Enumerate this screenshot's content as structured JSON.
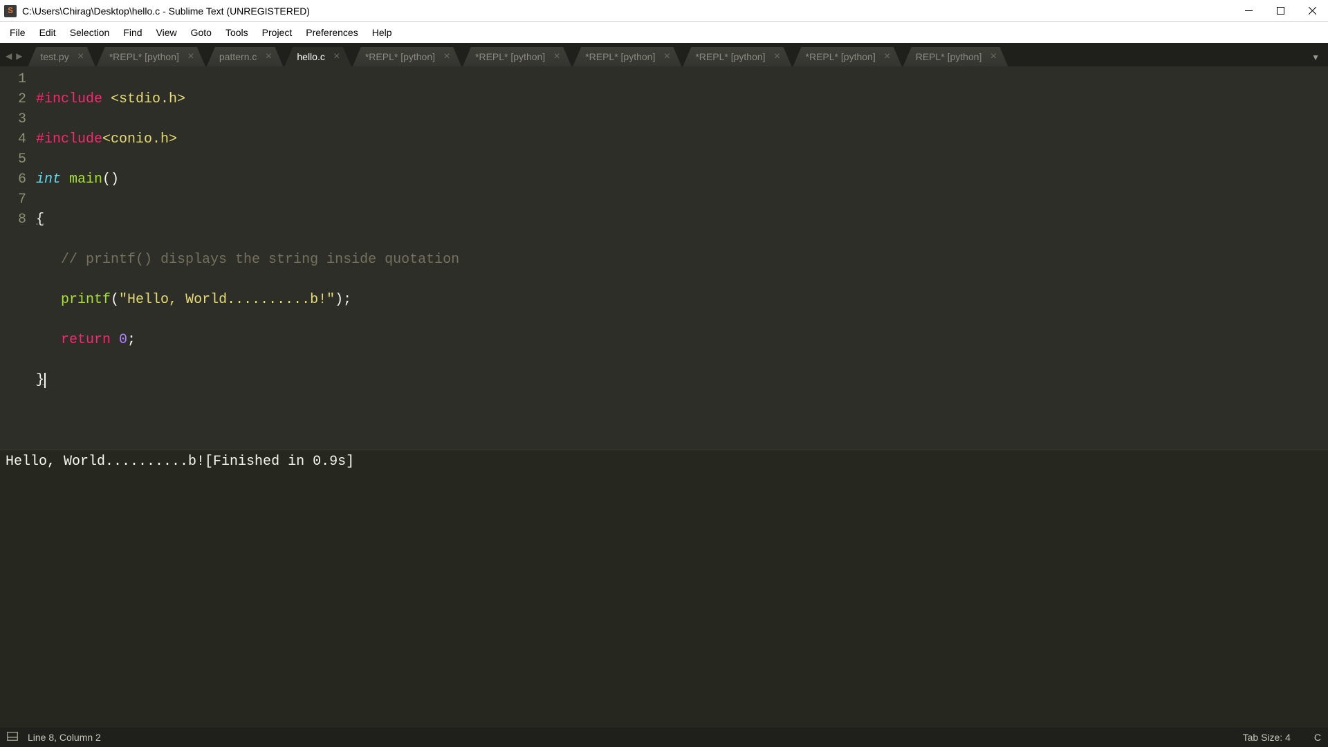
{
  "window": {
    "title": "C:\\Users\\Chirag\\Desktop\\hello.c - Sublime Text (UNREGISTERED)",
    "app_icon_letter": "S"
  },
  "menu": [
    "File",
    "Edit",
    "Selection",
    "Find",
    "View",
    "Goto",
    "Tools",
    "Project",
    "Preferences",
    "Help"
  ],
  "tabs": [
    {
      "label": "test.py",
      "active": false
    },
    {
      "label": "*REPL* [python]",
      "active": false
    },
    {
      "label": "pattern.c",
      "active": false
    },
    {
      "label": "hello.c",
      "active": true
    },
    {
      "label": "*REPL* [python]",
      "active": false
    },
    {
      "label": "*REPL* [python]",
      "active": false
    },
    {
      "label": "*REPL* [python]",
      "active": false
    },
    {
      "label": "*REPL* [python]",
      "active": false
    },
    {
      "label": "*REPL* [python]",
      "active": false
    },
    {
      "label": "REPL* [python]",
      "active": false
    }
  ],
  "code": {
    "line_numbers": [
      "1",
      "2",
      "3",
      "4",
      "5",
      "6",
      "7",
      "8"
    ],
    "l1_include": "#include",
    "l1_hdr": " <stdio.h>",
    "l2_include": "#include",
    "l2_hdr": "<conio.h>",
    "l3_type": "int",
    "l3_fn": " main",
    "l3_paren": "()",
    "l4_brace": "{",
    "l5_comment": "   // printf() displays the string inside quotation",
    "l6_fn": "   printf",
    "l6_open": "(",
    "l6_str": "\"Hello, World..........b!\"",
    "l6_close": ");",
    "l7_return": "   return ",
    "l7_num": "0",
    "l7_semi": ";",
    "l8_brace": "}"
  },
  "output": "Hello, World..........b![Finished in 0.9s]",
  "status": {
    "position": "Line 8, Column 2",
    "tab_size": "Tab Size: 4",
    "syntax": "C"
  }
}
